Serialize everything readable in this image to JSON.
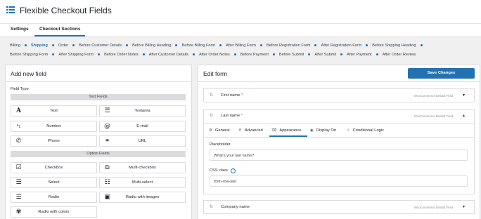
{
  "app": {
    "title": "Flexible Checkout Fields"
  },
  "tabs": [
    {
      "label": "Settings",
      "active": false
    },
    {
      "label": "Checkout Sections",
      "active": true
    }
  ],
  "sections_nav": {
    "items": [
      "Billing",
      "Shipping",
      "Order",
      "Before Customer Details",
      "Before Billing Heading",
      "Before Billing Form",
      "After Billing Form",
      "Before Registration Form",
      "After Registration Form",
      "Before Shipping Heading",
      "Before Shipping Form",
      "After Shipping Form",
      "Before Order Notes",
      "After Customer Details",
      "After Order Notes",
      "Before Payment",
      "Before Submit",
      "After Submit",
      "After Payment",
      "After Order Review"
    ],
    "current": "Shipping"
  },
  "left_panel": {
    "title": "Add new field",
    "field_type_label": "Field Type",
    "groups": [
      {
        "label": "Text Fields",
        "fields": [
          {
            "label": "Text",
            "icon": "text-a-icon"
          },
          {
            "label": "Textarea",
            "icon": "textarea-lines-icon"
          },
          {
            "label": "Number",
            "icon": "number-icon"
          },
          {
            "label": "E-mail",
            "icon": "at-sign-icon"
          },
          {
            "label": "Phone",
            "icon": "phone-icon"
          },
          {
            "label": "URL",
            "icon": "link-icon"
          }
        ]
      },
      {
        "label": "Option Fields",
        "fields": [
          {
            "label": "Checkbox",
            "icon": "checkbox-icon"
          },
          {
            "label": "Multi-checkbox",
            "icon": "multi-checkbox-icon"
          },
          {
            "label": "Select",
            "icon": "select-icon"
          },
          {
            "label": "Multi-select",
            "icon": "multi-select-icon"
          },
          {
            "label": "Radio",
            "icon": "radio-list-icon"
          },
          {
            "label": "Radio with images",
            "icon": "image-icon"
          },
          {
            "label": "Radio with colors",
            "icon": "palette-icon"
          }
        ]
      }
    ]
  },
  "right_panel": {
    "title": "Edit form",
    "save_label": "Save Changes",
    "rows": [
      {
        "name": "First name",
        "required_mark": "*",
        "tag": "WooCommerce Default Field",
        "expanded": false
      },
      {
        "name": "Last name",
        "required_mark": "*",
        "tag": "WooCommerce Default Field",
        "expanded": true
      },
      {
        "name": "Company name",
        "required_mark": "",
        "tag": "WooCommerce Default Field",
        "expanded": false
      }
    ],
    "edit_tabs": [
      {
        "label": "General",
        "icon": "gear-icon"
      },
      {
        "label": "Advanced",
        "icon": "sliders-icon"
      },
      {
        "label": "Appearance",
        "icon": "brush-icon",
        "active": true
      },
      {
        "label": "Display On",
        "icon": "eye-icon"
      },
      {
        "label": "Conditional Logic",
        "icon": "wand-icon"
      }
    ],
    "placeholder": {
      "label": "Placeholder",
      "value": "What's your last name?"
    },
    "css_class": {
      "label": "CSS class",
      "value": "form-row-last"
    }
  },
  "colors": {
    "accent": "#2271b1",
    "required": "#d63638",
    "border": "#dcdcde",
    "background": "#f0f0f1"
  }
}
